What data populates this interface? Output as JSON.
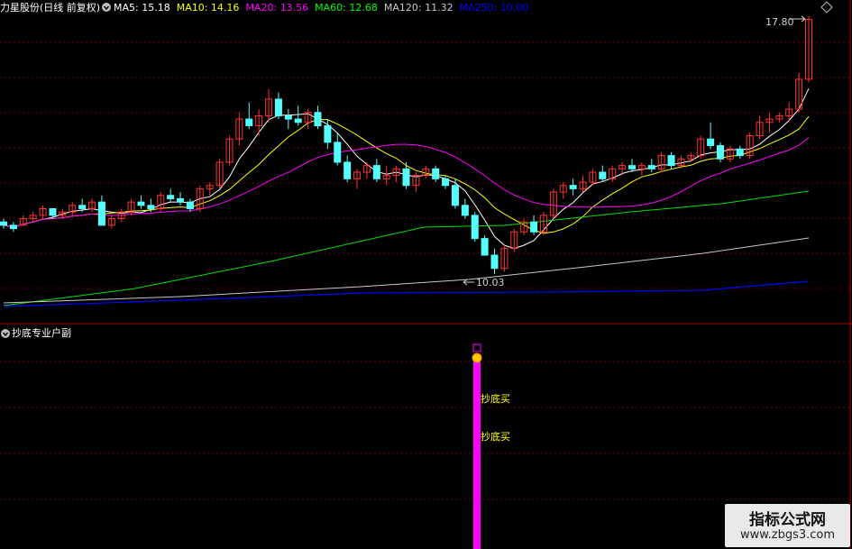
{
  "stock_title": "力星股份(日线 前复权)",
  "ma_legend": [
    {
      "text": "MA5: 15.18",
      "color": "#ffffff"
    },
    {
      "text": "MA10: 14.16",
      "color": "#ffff00"
    },
    {
      "text": "MA20: 13.56",
      "color": "#ff00ff"
    },
    {
      "text": "MA60: 12.68",
      "color": "#00ff00"
    },
    {
      "text": "MA120: 11.32",
      "color": "#c8c8c8"
    },
    {
      "text": "MA250: 10.00",
      "color": "#0000ff"
    }
  ],
  "high_label": "17.80",
  "low_label": "10.03",
  "indicator_title": "抄底专业户副",
  "signal_labels": [
    "抄底买",
    "抄底买"
  ],
  "watermark": {
    "line1": "指标公式网",
    "line2": "www.zbgs3.com"
  },
  "colors": {
    "up": "#ff3232",
    "down": "#54ffff",
    "grid": "#7a0000",
    "signal": "#ff00ff",
    "signal_text": "#ffff00"
  },
  "chart_data": {
    "type": "candlestick",
    "series_note": "OHLC daily candles, values estimated in price units",
    "high": 17.8,
    "low": 10.03,
    "candles": [
      [
        11.6,
        11.7,
        11.4,
        11.5
      ],
      [
        11.5,
        11.6,
        11.3,
        11.4
      ],
      [
        11.5,
        11.8,
        11.5,
        11.7
      ],
      [
        11.7,
        11.9,
        11.6,
        11.8
      ],
      [
        11.8,
        12.1,
        11.7,
        12.0
      ],
      [
        12.0,
        12.0,
        11.7,
        11.8
      ],
      [
        11.8,
        12.0,
        11.7,
        11.9
      ],
      [
        11.9,
        12.2,
        11.8,
        12.1
      ],
      [
        12.1,
        12.3,
        11.9,
        12.0
      ],
      [
        12.0,
        12.3,
        11.9,
        12.2
      ],
      [
        12.2,
        12.4,
        11.6,
        11.5
      ],
      [
        11.5,
        11.8,
        11.4,
        11.7
      ],
      [
        11.7,
        12.0,
        11.6,
        11.9
      ],
      [
        11.9,
        12.3,
        11.8,
        12.2
      ],
      [
        12.2,
        12.4,
        12.0,
        12.1
      ],
      [
        12.1,
        12.3,
        11.9,
        12.0
      ],
      [
        12.0,
        12.5,
        11.9,
        12.4
      ],
      [
        12.4,
        12.6,
        12.2,
        12.3
      ],
      [
        12.3,
        12.5,
        12.1,
        12.2
      ],
      [
        12.2,
        12.3,
        11.9,
        12.0
      ],
      [
        12.0,
        12.7,
        11.9,
        12.6
      ],
      [
        12.6,
        12.8,
        12.4,
        12.7
      ],
      [
        12.7,
        13.5,
        12.6,
        13.4
      ],
      [
        13.4,
        14.2,
        13.3,
        14.1
      ],
      [
        14.1,
        14.9,
        13.9,
        14.7
      ],
      [
        14.7,
        15.2,
        14.4,
        14.5
      ],
      [
        14.5,
        15.0,
        14.2,
        14.8
      ],
      [
        14.8,
        15.6,
        14.6,
        15.3
      ],
      [
        15.3,
        15.5,
        14.7,
        14.8
      ],
      [
        14.8,
        15.0,
        14.4,
        14.7
      ],
      [
        14.7,
        15.1,
        14.5,
        14.6
      ],
      [
        14.6,
        15.0,
        14.4,
        14.9
      ],
      [
        14.9,
        15.1,
        14.4,
        14.5
      ],
      [
        14.5,
        14.7,
        13.8,
        14.0
      ],
      [
        14.0,
        14.3,
        13.3,
        13.4
      ],
      [
        13.4,
        13.6,
        12.8,
        12.9
      ],
      [
        12.9,
        13.2,
        12.6,
        13.1
      ],
      [
        13.1,
        13.4,
        12.9,
        13.3
      ],
      [
        13.3,
        13.5,
        12.8,
        12.9
      ],
      [
        12.9,
        13.3,
        12.7,
        13.0
      ],
      [
        13.0,
        13.3,
        12.8,
        13.2
      ],
      [
        13.2,
        13.4,
        12.6,
        12.7
      ],
      [
        12.7,
        13.1,
        12.5,
        13.0
      ],
      [
        13.0,
        13.3,
        12.9,
        13.2
      ],
      [
        13.2,
        13.3,
        12.8,
        12.9
      ],
      [
        12.9,
        13.0,
        12.6,
        12.7
      ],
      [
        12.7,
        12.9,
        12.0,
        12.1
      ],
      [
        12.1,
        12.3,
        11.7,
        11.8
      ],
      [
        11.8,
        11.9,
        11.0,
        11.1
      ],
      [
        11.1,
        11.2,
        10.6,
        10.6
      ],
      [
        10.6,
        10.8,
        10.03,
        10.2
      ],
      [
        10.2,
        10.9,
        10.1,
        10.8
      ],
      [
        10.8,
        11.4,
        10.7,
        11.3
      ],
      [
        11.3,
        11.7,
        11.2,
        11.6
      ],
      [
        11.6,
        11.8,
        11.2,
        11.3
      ],
      [
        11.3,
        11.9,
        11.2,
        11.8
      ],
      [
        11.8,
        12.6,
        11.7,
        12.5
      ],
      [
        12.5,
        12.8,
        12.3,
        12.7
      ],
      [
        12.7,
        12.9,
        12.4,
        12.6
      ],
      [
        12.6,
        13.0,
        12.5,
        12.8
      ],
      [
        12.8,
        13.2,
        12.7,
        13.1
      ],
      [
        13.1,
        13.3,
        12.8,
        12.9
      ],
      [
        12.9,
        13.3,
        12.8,
        13.2
      ],
      [
        13.2,
        13.4,
        13.0,
        13.3
      ],
      [
        13.3,
        13.5,
        13.1,
        13.2
      ],
      [
        13.2,
        13.4,
        13.0,
        13.3
      ],
      [
        13.3,
        13.5,
        13.1,
        13.2
      ],
      [
        13.2,
        13.7,
        13.1,
        13.6
      ],
      [
        13.6,
        13.7,
        13.2,
        13.3
      ],
      [
        13.3,
        13.6,
        13.2,
        13.5
      ],
      [
        13.5,
        13.7,
        13.4,
        13.6
      ],
      [
        13.6,
        14.2,
        13.5,
        14.1
      ],
      [
        14.1,
        14.6,
        13.8,
        13.9
      ],
      [
        13.9,
        14.0,
        13.4,
        13.5
      ],
      [
        13.5,
        13.9,
        13.4,
        13.8
      ],
      [
        13.8,
        13.9,
        13.5,
        13.6
      ],
      [
        13.6,
        14.3,
        13.5,
        14.2
      ],
      [
        14.2,
        14.8,
        14.1,
        14.6
      ],
      [
        14.6,
        14.9,
        14.3,
        14.7
      ],
      [
        14.7,
        14.9,
        14.6,
        14.8
      ],
      [
        14.8,
        15.2,
        14.6,
        15.0
      ],
      [
        15.0,
        16.1,
        14.9,
        15.9
      ],
      [
        15.9,
        17.8,
        15.8,
        17.7
      ]
    ]
  }
}
